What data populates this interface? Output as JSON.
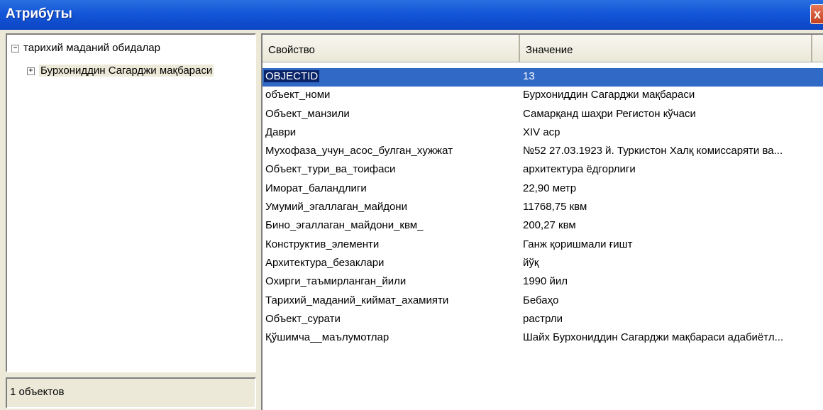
{
  "window": {
    "title": "Атрибуты",
    "close_label": "x"
  },
  "tree": {
    "root_label": "тарихий маданий обидалар",
    "child_label": "Бурхониддин Сагарджи мақбараси",
    "root_expander": "−",
    "child_expander": "+"
  },
  "status": {
    "count_text": "1 объектов"
  },
  "table": {
    "columns": [
      "Свойство",
      "Значение"
    ],
    "rows": [
      {
        "key": "OBJECTID",
        "value": "13"
      },
      {
        "key": "объект_номи",
        "value": "Бурхониддин Сагарджи мақбараси"
      },
      {
        "key": "Объект_манзили",
        "value": "Самарқанд шаҳри Регистон кўчаси"
      },
      {
        "key": "Даври",
        "value": "XIV аср"
      },
      {
        "key": "Мухофаза_учун_асос_булган_хужжат",
        "value": "№52 27.03.1923 й. Туркистон Халқ комиссаряти ва..."
      },
      {
        "key": "Объект_тури_ва_тоифаси",
        "value": "архитектура ёдгорлиги"
      },
      {
        "key": "Иморат_баландлиги",
        "value": "22,90 метр"
      },
      {
        "key": "Умумий_эгаллаган_майдони",
        "value": "11768,75 квм"
      },
      {
        "key": "Бино_эгаллаган_майдони_квм_",
        "value": "200,27 квм"
      },
      {
        "key": "Конструктив_элементи",
        "value": "Ганж қоришмали ғишт"
      },
      {
        "key": "Архитектура_безаклари",
        "value": "йўқ"
      },
      {
        "key": "Охирги_таъмирланган_йили",
        "value": "1990 йил"
      },
      {
        "key": "Тарихий_маданий_киймат_ахамияти",
        "value": "Бебаҳо"
      },
      {
        "key": "Объект_сурати",
        "value": "растрли"
      },
      {
        "key": "Қўшимча__маълумотлар",
        "value": "Шайх Бурхониддин Сагарджи мақбараси адабиётл..."
      }
    ]
  },
  "colors": {
    "titlebar": "#1456d8",
    "selection": "#3169c6",
    "selection_key": "#0a246a",
    "frame": "#ece9d8"
  }
}
